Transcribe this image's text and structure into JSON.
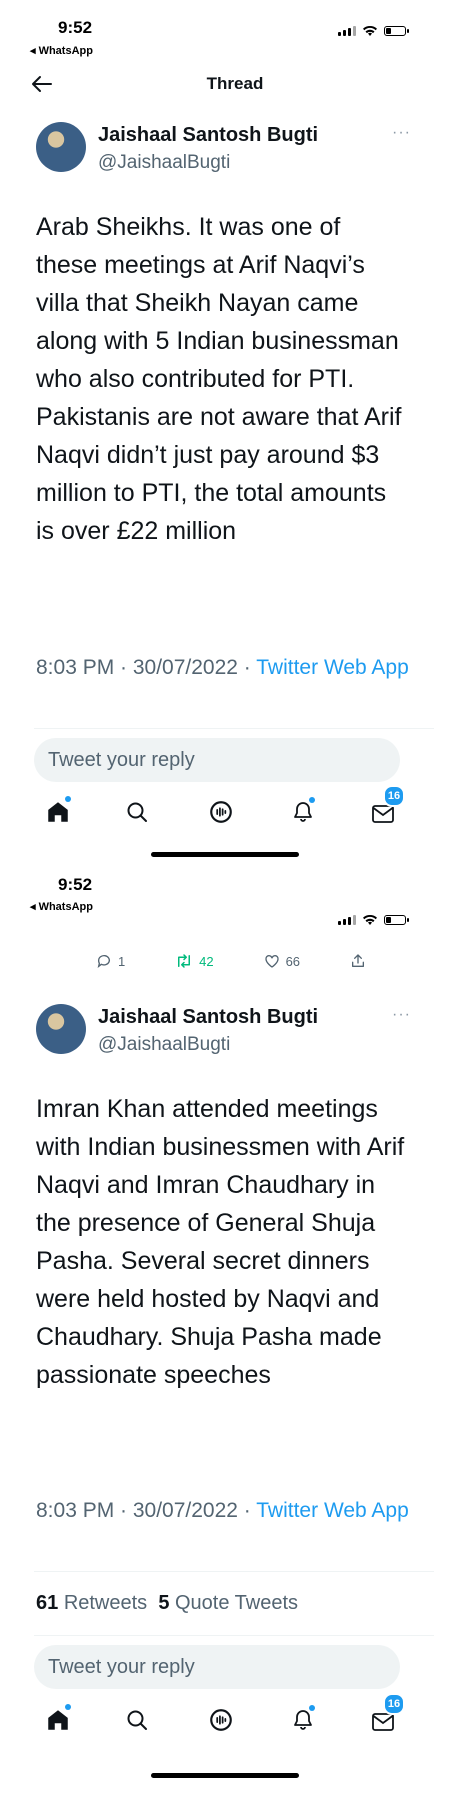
{
  "screen1": {
    "status": {
      "time": "9:52",
      "back_app": "◂ WhatsApp"
    },
    "header": {
      "title": "Thread"
    },
    "tweet": {
      "name": "Jaishaal Santosh Bugti",
      "handle": "@JaishaalBugti",
      "text": "Arab Sheikhs. It was one of these meetings at Arif Naqvi’s villa that Sheikh Nayan came along with 5 Indian businessman who also contributed for PTI. Pakistanis are not aware that Arif Naqvi didn’t just pay around $3 million to PTI, the total amounts is over £22 million",
      "time_date": "8:03 PM · 30/07/2022 · ",
      "source": "Twitter Web App"
    },
    "reply_placeholder": "Tweet your reply",
    "nav": {
      "badge_count": "16"
    }
  },
  "screen2": {
    "status": {
      "time": "9:52",
      "back_app": "◂ WhatsApp"
    },
    "prev_actions": {
      "replies": "1",
      "retweets": "42",
      "likes": "66"
    },
    "tweet": {
      "name": "Jaishaal Santosh Bugti",
      "handle": "@JaishaalBugti",
      "text": "Imran Khan attended meetings with Indian businessmen with Arif Naqvi and Imran Chaudhary in the presence of General Shuja Pasha. Several secret dinners were held hosted by Naqvi and Chaudhary. Shuja Pasha made passionate speeches",
      "time_date": "8:03 PM · 30/07/2022 · ",
      "source": "Twitter Web App"
    },
    "stats": {
      "retweets_count": "61",
      "retweets_label": "Retweets",
      "quotes_count": "5",
      "quotes_label": "Quote Tweets"
    },
    "reply_placeholder": "Tweet your reply",
    "nav": {
      "badge_count": "16"
    }
  },
  "colors": {
    "accent": "#1d9bf0",
    "text": "#0f1419",
    "muted": "#536471",
    "surface": "#eff3f4"
  },
  "icons": [
    "back-arrow-icon",
    "home-icon",
    "search-icon",
    "spaces-icon",
    "notifications-icon",
    "messages-icon",
    "reply-icon",
    "retweet-icon",
    "like-icon",
    "share-icon",
    "more-icon"
  ]
}
